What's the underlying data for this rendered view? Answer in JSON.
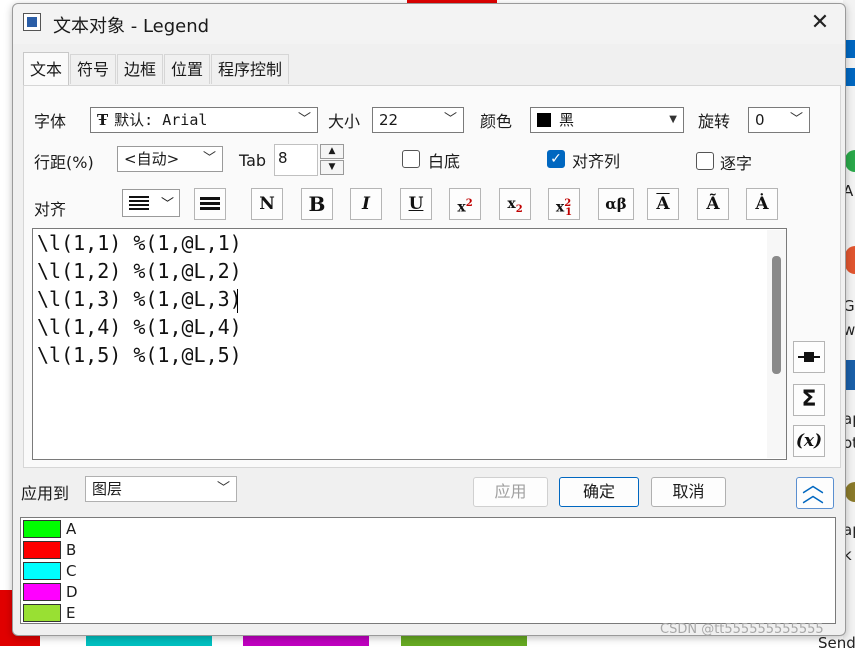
{
  "window": {
    "title": "文本对象 - Legend"
  },
  "tabs": [
    {
      "label": "文本",
      "active": true
    },
    {
      "label": "符号"
    },
    {
      "label": "边框"
    },
    {
      "label": "位置"
    },
    {
      "label": "程序控制"
    }
  ],
  "font": {
    "label": "字体",
    "value": "默认: Arial",
    "icon": "truetype-icon"
  },
  "size": {
    "label": "大小",
    "value": "22"
  },
  "color": {
    "label": "颜色",
    "value": "黑",
    "swatch": "#000000"
  },
  "rotation": {
    "label": "旋转",
    "value": "0"
  },
  "line_spacing": {
    "label": "行距(%)",
    "value": "<自动>"
  },
  "tab_width": {
    "label": "Tab",
    "value": "8"
  },
  "white_bg": {
    "label": "白底",
    "checked": false
  },
  "align_columns": {
    "label": "对齐列",
    "checked": true
  },
  "char_by_char": {
    "label": "逐字",
    "checked": false
  },
  "align": {
    "label": "对齐"
  },
  "format_buttons": [
    {
      "name": "normal-button",
      "text": "N"
    },
    {
      "name": "bold-button",
      "text": "B"
    },
    {
      "name": "italic-button",
      "text": "I"
    },
    {
      "name": "underline-button",
      "text": "U"
    },
    {
      "name": "superscript-button",
      "text": "x²"
    },
    {
      "name": "subscript-button",
      "text": "x₂"
    },
    {
      "name": "super-subscript-button",
      "text": "x²₁"
    },
    {
      "name": "greek-button",
      "text": "αβ"
    },
    {
      "name": "overline-button",
      "text": "A"
    },
    {
      "name": "tilde-button",
      "text": "Ã"
    },
    {
      "name": "dot-above-button",
      "text": "Ȧ"
    }
  ],
  "editor": {
    "lines": [
      "\\l(1,1) %(1,@L,1)",
      "\\l(1,2) %(1,@L,2)",
      "\\l(1,3) %(1,@L,3)",
      "\\l(1,4) %(1,@L,4)",
      "\\l(1,5) %(1,@L,5)"
    ]
  },
  "side_buttons": [
    {
      "name": "insert-symbol-button",
      "icon": "line-symbol-icon"
    },
    {
      "name": "sigma-button",
      "text": "Σ"
    },
    {
      "name": "variable-button",
      "text": "(x)"
    }
  ],
  "apply_to": {
    "label": "应用到",
    "value": "图层"
  },
  "buttons": {
    "apply": "应用",
    "ok": "确定",
    "cancel": "取消"
  },
  "legend_preview": [
    {
      "label": "A",
      "color": "#00ff00"
    },
    {
      "label": "B",
      "color": "#ff0000"
    },
    {
      "label": "C",
      "color": "#00ffff"
    },
    {
      "label": "D",
      "color": "#ff00ff"
    },
    {
      "label": "E",
      "color": "#99e033"
    }
  ],
  "background": {
    "right_texts": [
      "A",
      "Gr",
      "w",
      "ap",
      "ot",
      "ap",
      "k",
      "Send Gr"
    ],
    "bottom_bar_colors": [
      "#00c0c0",
      "#c000c0",
      "#66aa22"
    ]
  },
  "watermark": "CSDN @tt555555555555"
}
